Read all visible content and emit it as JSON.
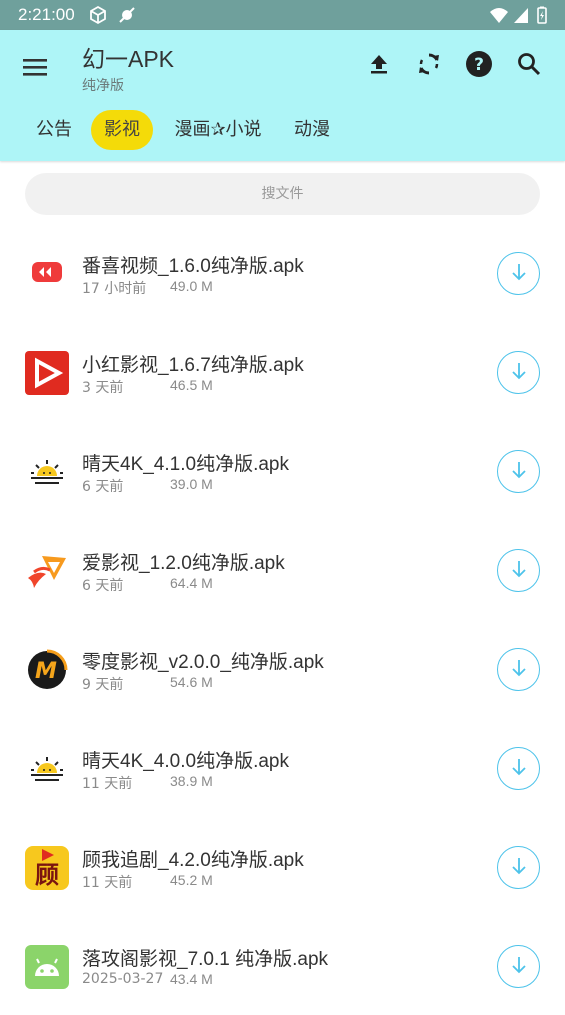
{
  "status": {
    "time": "2:21:00"
  },
  "header": {
    "title": "幻一APK",
    "subtitle": "纯净版"
  },
  "toolbar": {
    "icons": [
      "menu-icon",
      "upload-icon",
      "refresh-icon",
      "help-icon",
      "search-icon"
    ]
  },
  "tabs": [
    {
      "label": "公告",
      "active": false
    },
    {
      "label": "影视",
      "active": true
    },
    {
      "label": "漫画✰小说",
      "active": false
    },
    {
      "label": "动漫",
      "active": false
    }
  ],
  "search": {
    "placeholder": "搜文件"
  },
  "colors": {
    "accent": "#aef5f7",
    "status_bar": "#6fa09c",
    "active_tab": "#f4db09",
    "download": "#4dc3ea"
  },
  "files": [
    {
      "name": "番喜视频_1.6.0纯净版.apk",
      "time": "17 小时前",
      "size": "49.0 M",
      "icon": "fanxi-app-icon"
    },
    {
      "name": "小红影视_1.6.7纯净版.apk",
      "time": "3 天前",
      "size": "46.5 M",
      "icon": "xiaohong-app-icon"
    },
    {
      "name": "晴天4K_4.1.0纯净版.apk",
      "time": "6 天前",
      "size": "39.0 M",
      "icon": "sunrise-app-icon"
    },
    {
      "name": "爱影视_1.2.0纯净版.apk",
      "time": "6 天前",
      "size": "64.4 M",
      "icon": "aiyingshi-app-icon"
    },
    {
      "name": "零度影视_v2.0.0_纯净版.apk",
      "time": "9 天前",
      "size": "54.6 M",
      "icon": "lingdu-app-icon"
    },
    {
      "name": "晴天4K_4.0.0纯净版.apk",
      "time": "11 天前",
      "size": "38.9 M",
      "icon": "sunrise-app-icon"
    },
    {
      "name": "顾我追剧_4.2.0纯净版.apk",
      "time": "11 天前",
      "size": "45.2 M",
      "icon": "guwo-app-icon"
    },
    {
      "name": "落攻阁影视_7.0.1 纯净版.apk",
      "time": "2025-03-27",
      "size": "43.4 M",
      "icon": "android-app-icon"
    }
  ],
  "app_icon_text": {
    "lingdu": "M",
    "guwo": "顾"
  }
}
